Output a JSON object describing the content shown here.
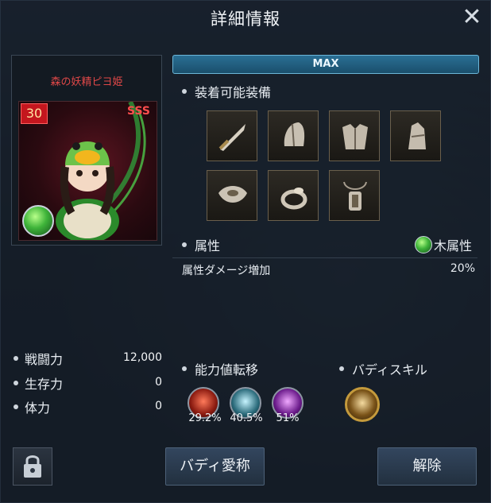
{
  "window": {
    "title": "詳細情報"
  },
  "buddy_card": {
    "name": "森の妖精ピヨ姫",
    "level": "30",
    "rank": "SSS"
  },
  "level_bar": {
    "label": "MAX"
  },
  "equippable": {
    "title": "装着可能装備",
    "slots": [
      "sword-icon",
      "helmet-icon",
      "armor-icon",
      "gauntlet-icon",
      "shoulder-icon",
      "ring-icon",
      "necklace-icon"
    ]
  },
  "attribute": {
    "title": "属性",
    "element": "木属性",
    "damage_label": "属性ダメージ増加",
    "damage_value": "20%"
  },
  "stats": {
    "combat": {
      "label": "戦闘力",
      "value": "12,000"
    },
    "survival": {
      "label": "生存力",
      "value": "0"
    },
    "stamina": {
      "label": "体力",
      "value": "0"
    }
  },
  "transfer": {
    "title": "能力値転移",
    "items": [
      {
        "icon": "attack-transfer-icon",
        "value": "29.2%"
      },
      {
        "icon": "defense-transfer-icon",
        "value": "40.5%"
      },
      {
        "icon": "magic-transfer-icon",
        "value": "51%"
      }
    ]
  },
  "skill": {
    "title": "バディスキル"
  },
  "buttons": {
    "nickname": "バディ愛称",
    "release": "解除"
  },
  "colors": {
    "max_bar": "#1a4f6c",
    "rank_red": "#ff4d4d",
    "element_green": "#3fb43a"
  }
}
